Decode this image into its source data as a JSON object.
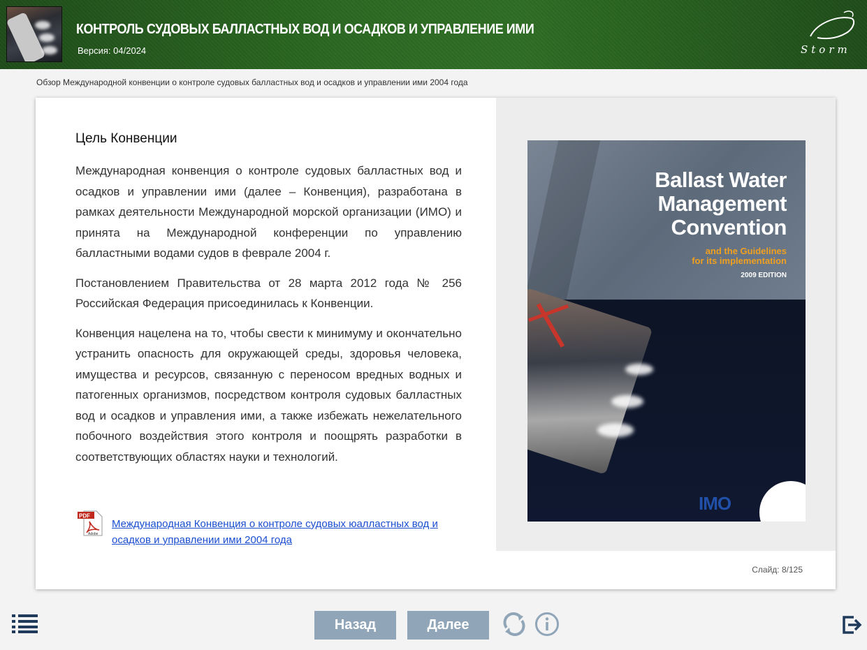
{
  "header": {
    "title": "КОНТРОЛЬ СУДОВЫХ БАЛЛАСТНЫХ ВОД И ОСАДКОВ И УПРАВЛЕНИЕ ИМИ",
    "version": "Версия: 04/2024",
    "logo_text": "Storm"
  },
  "breadcrumb": "Обзор Международной конвенции о контроле судовых балластных вод и осадков и управлении ими 2004 года",
  "content": {
    "heading": "Цель Конвенции",
    "paragraphs": [
      "Международная конвенция о контроле судовых балластных вод и осадков и управлении ими (далее – Конвенция), разработана в рамках деятельности Международной морской организации (ИМО) и принята на Международной конференции по управлению балластными водами судов в феврале 2004 г.",
      "Постановлением Правительства от 28 марта 2012 года № 256 Российская Федерация присоединилась к Конвенции.",
      "Конвенция нацелена на то, чтобы свести к минимуму и окончательно устранить опасность для окружающей среды, здоровья человека, имущества и ресурсов, связанную с переносом вредных водных и патогенных организмов, посредством контроля судовых балластных вод и осадков и управления ими, а также избежать нежелательного побочного воздействия этого контроля и поощрять разработки в соответствующих областях науки и технологий."
    ],
    "pdf_link": "Международная Конвенция о контроле судовых юалластных вод и осадков и управлении ими 2004 года",
    "pdf_icon_label": "PDF",
    "pdf_icon_brand": "Adobe"
  },
  "book": {
    "title_line1": "Ballast Water",
    "title_line2": "Management",
    "title_line3": "Convention",
    "subtitle_line1": "and the Guidelines",
    "subtitle_line2": "for its implementation",
    "edition": "2009 EDITION",
    "publisher": "IMO"
  },
  "slide_counter": "Слайд:  8/125",
  "footer": {
    "back_label": "Назад",
    "next_label": "Далее"
  },
  "colors": {
    "header_green": "#2c6a22",
    "button": "#90a6b8",
    "link": "#1a4ed0",
    "icon_navy": "#1f3a5a"
  }
}
